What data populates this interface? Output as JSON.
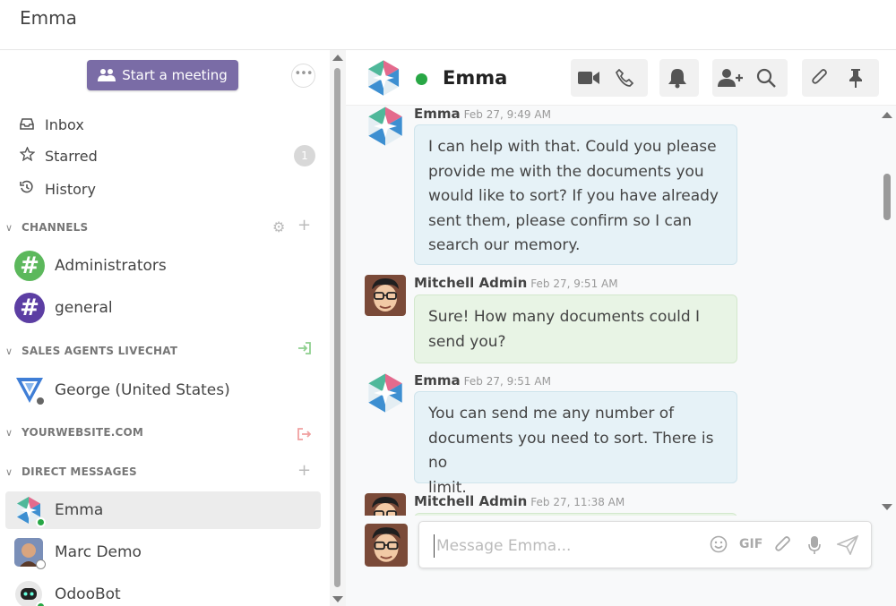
{
  "window": {
    "title": "Emma"
  },
  "sidebar": {
    "meeting_button": "Start a meeting",
    "more_label": "•••",
    "nav": [
      {
        "label": "Inbox",
        "icon": "inbox-icon"
      },
      {
        "label": "Starred",
        "icon": "star-icon",
        "badge": "1"
      },
      {
        "label": "History",
        "icon": "history-icon"
      }
    ],
    "sections": {
      "channels": "CHANNELS",
      "livechat": "SALES AGENTS LIVECHAT",
      "website": "YOURWEBSITE.COM",
      "direct": "DIRECT MESSAGES"
    },
    "channels": [
      {
        "label": "Administrators",
        "symbol": "#",
        "color": "#5cb85c"
      },
      {
        "label": "general",
        "symbol": "#",
        "color": "#5c3ea3"
      }
    ],
    "livechat_items": [
      {
        "label": "George (United States)"
      }
    ],
    "direct_messages": [
      {
        "label": "Emma",
        "presence": "online"
      },
      {
        "label": "Marc Demo",
        "presence": "offline"
      },
      {
        "label": "OdooBot",
        "presence": "online"
      }
    ]
  },
  "chat": {
    "name": "Emma",
    "status": "online",
    "header_icons": [
      "video-icon",
      "phone-icon",
      "bell-icon",
      "add-user-icon",
      "search-icon",
      "paperclip-icon",
      "pin-icon"
    ],
    "messages": [
      {
        "author": "Emma",
        "time": "Feb 27, 9:49 AM",
        "role": "bot",
        "lines": [
          "I can help with that. Could you please",
          "provide me with the documents you",
          "would like to sort? If you have already",
          "sent them, please confirm so I can",
          "search our memory."
        ]
      },
      {
        "author": "Mitchell Admin",
        "time": "Feb 27, 9:51 AM",
        "role": "user",
        "lines": [
          "Sure! How many documents could I",
          "send you?"
        ]
      },
      {
        "author": "Emma",
        "time": "Feb 27, 9:51 AM",
        "role": "bot",
        "lines": [
          "You can send me any number of",
          "documents you need to sort. There is no",
          "limit."
        ]
      },
      {
        "author": "Mitchell Admin",
        "time": "Feb 27, 11:38 AM",
        "role": "user",
        "lines": []
      }
    ]
  },
  "composer": {
    "placeholder": "Message Emma...",
    "gif_label": "GIF"
  },
  "colors": {
    "accent": "#7a6ca6",
    "online": "#28a745",
    "bot_bubble": "#e6f2f7",
    "user_bubble": "#e8f4e5"
  }
}
